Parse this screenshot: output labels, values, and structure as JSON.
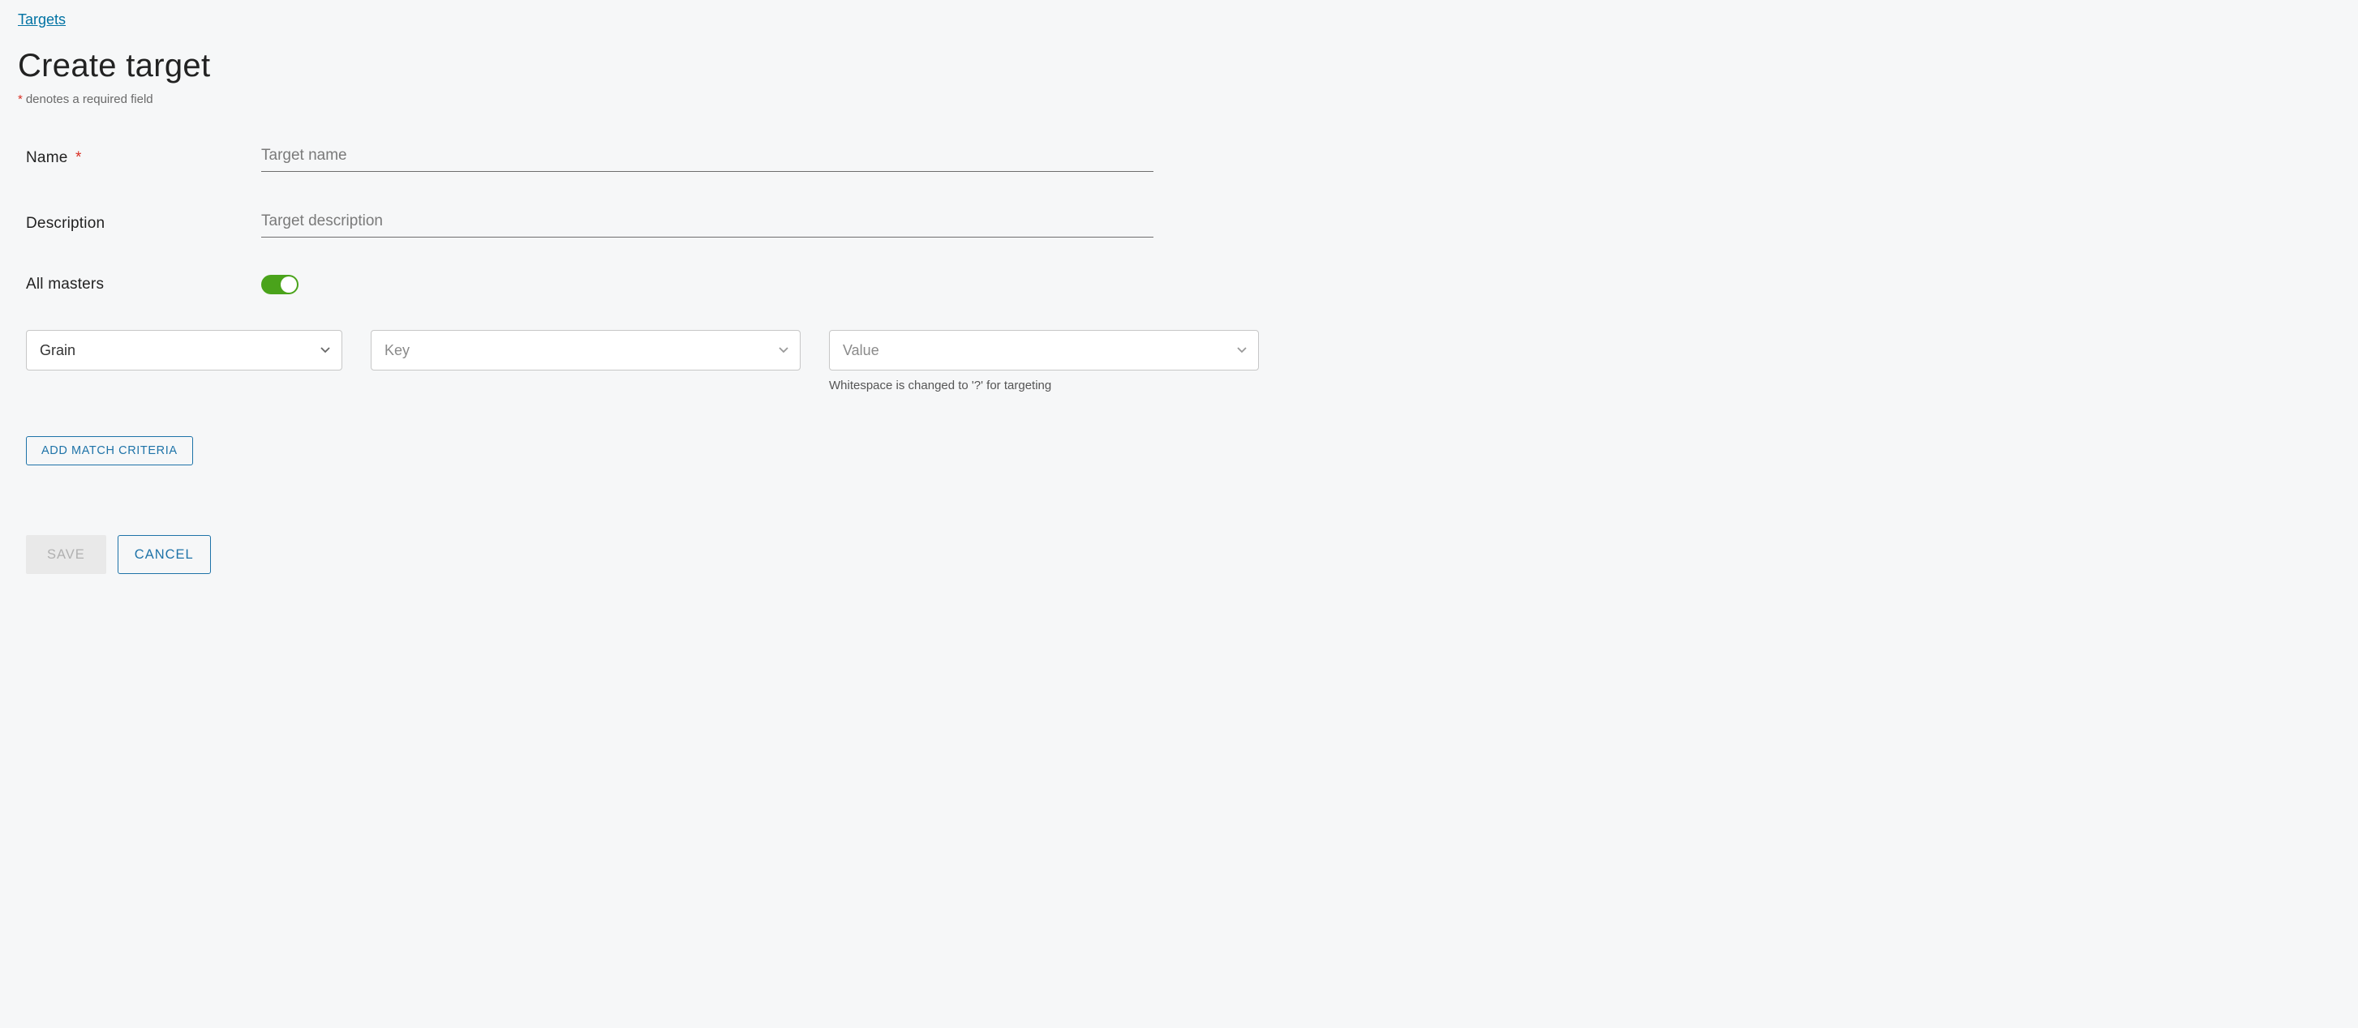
{
  "breadcrumb": {
    "parent_label": "Targets"
  },
  "header": {
    "title": "Create target",
    "required_hint": "denotes a required field"
  },
  "fields": {
    "name": {
      "label": "Name",
      "placeholder": "Target name",
      "required": true
    },
    "description": {
      "label": "Description",
      "placeholder": "Target description",
      "required": false
    },
    "all_masters": {
      "label": "All masters",
      "value": true
    }
  },
  "criteria": {
    "type": {
      "selected": "Grain"
    },
    "key": {
      "placeholder": "Key"
    },
    "value": {
      "placeholder": "Value",
      "helper": "Whitespace is changed to '?' for targeting"
    },
    "add_label": "ADD MATCH CRITERIA"
  },
  "actions": {
    "save": "SAVE",
    "cancel": "CANCEL"
  }
}
